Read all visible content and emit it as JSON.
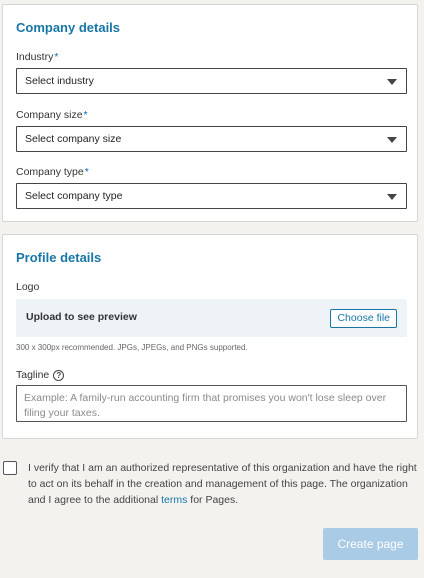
{
  "company_details": {
    "title": "Company details",
    "industry": {
      "label": "Industry",
      "required_mark": "*",
      "value": "Select industry"
    },
    "company_size": {
      "label": "Company size",
      "required_mark": "*",
      "value": "Select company size"
    },
    "company_type": {
      "label": "Company type",
      "required_mark": "*",
      "value": "Select company type"
    }
  },
  "profile_details": {
    "title": "Profile details",
    "logo_label": "Logo",
    "upload_text": "Upload to see preview",
    "choose_file_label": "Choose file",
    "helper_text": "300 x 300px recommended. JPGs, JPEGs, and PNGs supported.",
    "tagline_label": "Tagline",
    "tagline_help_icon": "?",
    "tagline_placeholder": "Example: A family-run accounting firm that promises you won't lose sleep over filing your taxes.",
    "tagline_value": ""
  },
  "verification": {
    "text_before_link": "I verify that I am an authorized representative of this organization and have the right to act on its behalf in the creation and management of this page. The organization and I agree to the additional ",
    "link_text": "terms",
    "text_after_link": " for Pages."
  },
  "create_button_label": "Create page",
  "colors": {
    "accent": "#1776a6",
    "page_background": "#f3f2ef",
    "disabled_button": "#a9cbe6"
  }
}
